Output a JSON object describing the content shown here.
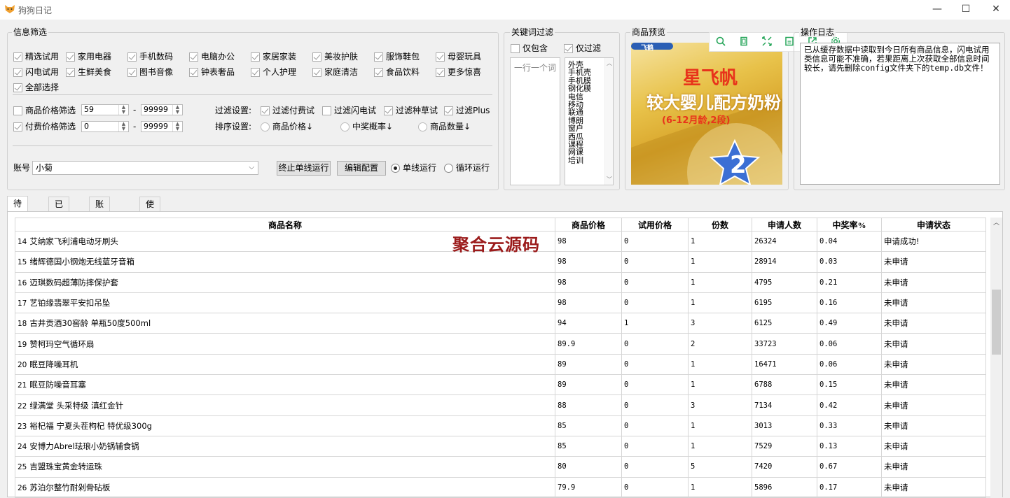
{
  "window": {
    "title": "狗狗日记",
    "minimize": "—",
    "maximize": "☐",
    "close": "✕"
  },
  "filter": {
    "title": "信息筛选",
    "categories": [
      {
        "label": "精选试用",
        "checked": true
      },
      {
        "label": "家用电器",
        "checked": true
      },
      {
        "label": "手机数码",
        "checked": true
      },
      {
        "label": "电脑办公",
        "checked": true
      },
      {
        "label": "家居家装",
        "checked": true
      },
      {
        "label": "美妆护肤",
        "checked": true
      },
      {
        "label": "服饰鞋包",
        "checked": true
      },
      {
        "label": "母婴玩具",
        "checked": true
      },
      {
        "label": "闪电试用",
        "checked": true
      },
      {
        "label": "生鲜美食",
        "checked": true
      },
      {
        "label": "图书音像",
        "checked": true
      },
      {
        "label": "钟表奢品",
        "checked": true
      },
      {
        "label": "个人护理",
        "checked": true
      },
      {
        "label": "家庭清洁",
        "checked": true
      },
      {
        "label": "食品饮料",
        "checked": true
      },
      {
        "label": "更多惊喜",
        "checked": true
      },
      {
        "label": "全部选择",
        "checked": true
      }
    ],
    "price_filter": {
      "label": "商品价格筛选",
      "checked": false,
      "min": "59",
      "max": "99999"
    },
    "paid_filter": {
      "label": "付费价格筛选",
      "checked": true,
      "min": "0",
      "max": "99999"
    },
    "dash": "-",
    "filter_settings": {
      "label": "过滤设置:",
      "options": [
        {
          "label": "过滤付费试",
          "checked": true
        },
        {
          "label": "过滤闪电试",
          "checked": false
        },
        {
          "label": "过滤种草试",
          "checked": true
        },
        {
          "label": "过滤Plus",
          "checked": true
        }
      ]
    },
    "sort_settings": {
      "label": "排序设置:",
      "options": [
        "商品价格↓",
        "中奖概率↓",
        "商品数量↓"
      ],
      "selected": 0
    },
    "account": {
      "label": "账号",
      "value": "小菊"
    },
    "stop_button": "终止单线运行",
    "edit_button": "编辑配置",
    "run_modes": [
      "单线运行",
      "循环运行"
    ],
    "run_mode_selected": 0
  },
  "keyword_filter": {
    "title": "关键词过滤",
    "only_include": {
      "label": "仅包含",
      "checked": false
    },
    "only_filter": {
      "label": "仅过滤",
      "checked": true
    },
    "placeholder": "一行一个词",
    "keywords": [
      "外壳",
      "手机壳",
      "手机膜",
      "钢化膜",
      "电信",
      "移动",
      "联通",
      "博朗",
      "窗户",
      "西瓜",
      "课程",
      "网课",
      "培训"
    ]
  },
  "preview": {
    "title": "商品预览",
    "brand": "星飞帆",
    "brand_top": "飞鹤",
    "product": "较大婴儿配方奶粉",
    "sub": "(6-12月龄,2段)",
    "stage": "2"
  },
  "toolbar": {
    "icons": [
      "search-icon",
      "copy-icon",
      "expand-icon",
      "save-icon",
      "share-icon",
      "gear-icon"
    ]
  },
  "log": {
    "title": "操作日志",
    "text": "已从缓存数据中读取到今日所有商品信息，闪电试用类信息可能不准确，若果距离上次获取全部信息时间较长，请先删除config文件夹下的temp.db文件！"
  },
  "tabs": [
    "待申请",
    "已中选",
    "账号管理",
    "使用说明"
  ],
  "active_tab": 0,
  "table": {
    "headers": [
      "商品名称",
      "商品价格",
      "试用价格",
      "份数",
      "申请人数",
      "中奖率%",
      "申请状态"
    ],
    "rows": [
      {
        "n": "14",
        "name": "艾纳家飞利浦电动牙刷头",
        "price": "98",
        "trial": "0",
        "qty": "1",
        "apply": "26324",
        "rate": "0.04",
        "status": "申请成功!"
      },
      {
        "n": "15",
        "name": "绪辉德国小钢炮无线蓝牙音箱",
        "price": "98",
        "trial": "0",
        "qty": "1",
        "apply": "28914",
        "rate": "0.03",
        "status": "未申请"
      },
      {
        "n": "16",
        "name": "迈琪数码超薄防摔保护套",
        "price": "98",
        "trial": "0",
        "qty": "1",
        "apply": "4795",
        "rate": "0.21",
        "status": "未申请"
      },
      {
        "n": "17",
        "name": "艺铂缘翡翠平安扣吊坠",
        "price": "98",
        "trial": "0",
        "qty": "1",
        "apply": "6195",
        "rate": "0.16",
        "status": "未申请"
      },
      {
        "n": "18",
        "name": "古井贡酒30窖龄 单瓶50度500ml",
        "price": "94",
        "trial": "1",
        "qty": "3",
        "apply": "6125",
        "rate": "0.49",
        "status": "未申请"
      },
      {
        "n": "19",
        "name": "赞柯玛空气循环扇",
        "price": "89.9",
        "trial": "0",
        "qty": "2",
        "apply": "33723",
        "rate": "0.06",
        "status": "未申请"
      },
      {
        "n": "20",
        "name": "眠豆降噪耳机",
        "price": "89",
        "trial": "0",
        "qty": "1",
        "apply": "16471",
        "rate": "0.06",
        "status": "未申请"
      },
      {
        "n": "21",
        "name": "眠豆防噪音耳塞",
        "price": "89",
        "trial": "0",
        "qty": "1",
        "apply": "6788",
        "rate": "0.15",
        "status": "未申请"
      },
      {
        "n": "22",
        "name": "绿满堂 头采特级 滇红金针",
        "price": "88",
        "trial": "0",
        "qty": "3",
        "apply": "7134",
        "rate": "0.42",
        "status": "未申请"
      },
      {
        "n": "23",
        "name": "裕杞福 宁夏头茬枸杞 特优级300g",
        "price": "85",
        "trial": "0",
        "qty": "1",
        "apply": "3013",
        "rate": "0.33",
        "status": "未申请"
      },
      {
        "n": "24",
        "name": "安博力Abrel珐琅小奶锅辅食锅",
        "price": "85",
        "trial": "0",
        "qty": "1",
        "apply": "7529",
        "rate": "0.13",
        "status": "未申请"
      },
      {
        "n": "25",
        "name": "吉盟珠宝黄金转运珠",
        "price": "80",
        "trial": "0",
        "qty": "5",
        "apply": "7420",
        "rate": "0.67",
        "status": "未申请"
      },
      {
        "n": "26",
        "name": "苏泊尔整竹耐剁骨砧板",
        "price": "79.9",
        "trial": "0",
        "qty": "1",
        "apply": "5896",
        "rate": "0.17",
        "status": "未申请"
      }
    ]
  },
  "watermark": "聚合云源码"
}
